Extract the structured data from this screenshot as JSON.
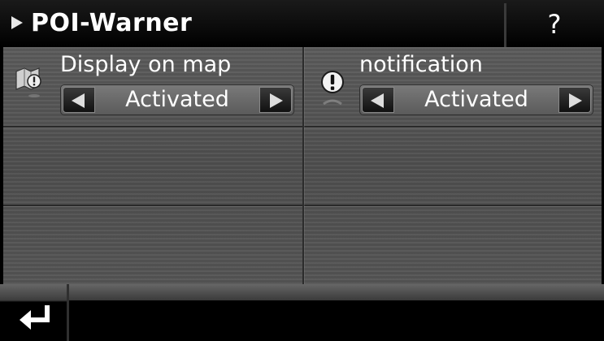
{
  "header": {
    "title": "POI-Warner",
    "help_label": "?"
  },
  "settings": [
    {
      "label": "Display on map",
      "value": "Activated",
      "icon": "poi-map-icon"
    },
    {
      "label": "notification",
      "value": "Activated",
      "icon": "warning-icon"
    }
  ],
  "footer": {
    "back_icon": "return-arrow-icon"
  },
  "colors": {
    "header_bg": "#000000",
    "panel_bg": "#555555",
    "text": "#ffffff"
  }
}
